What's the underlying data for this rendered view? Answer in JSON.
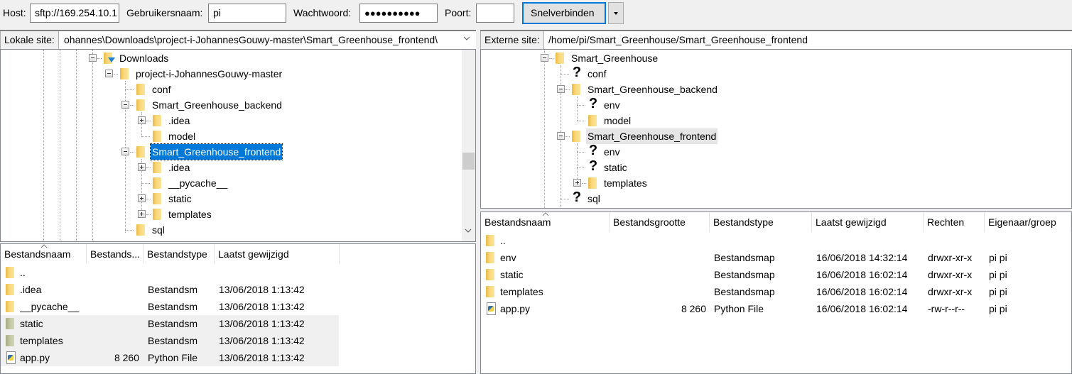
{
  "quickconnect": {
    "host_label": "Host:",
    "host_value": "sftp://169.254.10.1",
    "user_label": "Gebruikersnaam:",
    "user_value": "pi",
    "password_label": "Wachtwoord:",
    "password_value": "●●●●●●●●●●",
    "port_label": "Poort:",
    "port_value": "",
    "connect_label": "Snelverbinden",
    "dropdown_icon": "chevron-down-icon"
  },
  "local": {
    "site_label": "Lokale site:",
    "site_path": "ohannes\\Downloads\\project-i-JohannesGouwy-master\\Smart_Greenhouse_frontend\\",
    "tree": [
      {
        "label": "Downloads",
        "icon": "download-folder-icon",
        "expander": "minus"
      },
      {
        "label": "project-i-JohannesGouwy-master",
        "icon": "folder-icon",
        "expander": "minus"
      },
      {
        "label": "conf",
        "icon": "folder-icon",
        "expander": ""
      },
      {
        "label": "Smart_Greenhouse_backend",
        "icon": "folder-icon",
        "expander": "minus"
      },
      {
        "label": ".idea",
        "icon": "folder-icon",
        "expander": "plus"
      },
      {
        "label": "model",
        "icon": "folder-icon",
        "expander": ""
      },
      {
        "label": "Smart_Greenhouse_frontend",
        "icon": "folder-icon",
        "expander": "minus",
        "selected": true
      },
      {
        "label": ".idea",
        "icon": "folder-icon",
        "expander": "plus"
      },
      {
        "label": "__pycache__",
        "icon": "folder-icon",
        "expander": ""
      },
      {
        "label": "static",
        "icon": "folder-icon",
        "expander": "plus"
      },
      {
        "label": "templates",
        "icon": "folder-icon",
        "expander": "plus"
      },
      {
        "label": "sql",
        "icon": "folder-icon",
        "expander": ""
      }
    ],
    "columns": [
      "Bestandsnaam",
      "Bestands...",
      "Bestandstype",
      "Laatst gewijzigd"
    ],
    "files": [
      {
        "name": "..",
        "size": "",
        "type": "",
        "modified": "",
        "icon": "folder-icon"
      },
      {
        "name": ".idea",
        "size": "",
        "type": "Bestandsm",
        "modified": "13/06/2018 1:13:42",
        "icon": "folder-icon"
      },
      {
        "name": "__pycache__",
        "size": "",
        "type": "Bestandsm",
        "modified": "13/06/2018 1:13:42",
        "icon": "folder-icon"
      },
      {
        "name": "static",
        "size": "",
        "type": "Bestandsm",
        "modified": "13/06/2018 1:13:42",
        "icon": "folder-icon-grey",
        "shaded": true
      },
      {
        "name": "templates",
        "size": "",
        "type": "Bestandsm",
        "modified": "13/06/2018 1:13:42",
        "icon": "folder-icon-grey",
        "shaded": true
      },
      {
        "name": "app.py",
        "size": "8 260",
        "type": "Python File",
        "modified": "13/06/2018 1:13:42",
        "icon": "python-file-icon",
        "shaded": true
      }
    ]
  },
  "remote": {
    "site_label": "Externe site:",
    "site_path": "/home/pi/Smart_Greenhouse/Smart_Greenhouse_frontend",
    "tree": [
      {
        "label": "Smart_Greenhouse",
        "icon": "folder-icon",
        "expander": "minus"
      },
      {
        "label": "conf",
        "icon": "unknown-folder-icon",
        "expander": ""
      },
      {
        "label": "Smart_Greenhouse_backend",
        "icon": "folder-icon",
        "expander": "minus"
      },
      {
        "label": "env",
        "icon": "unknown-folder-icon",
        "expander": ""
      },
      {
        "label": "model",
        "icon": "folder-icon",
        "expander": ""
      },
      {
        "label": "Smart_Greenhouse_frontend",
        "icon": "folder-icon",
        "expander": "minus",
        "highlighted": true
      },
      {
        "label": "env",
        "icon": "unknown-folder-icon",
        "expander": ""
      },
      {
        "label": "static",
        "icon": "unknown-folder-icon",
        "expander": ""
      },
      {
        "label": "templates",
        "icon": "folder-icon",
        "expander": "plus"
      },
      {
        "label": "sql",
        "icon": "unknown-folder-icon",
        "expander": ""
      }
    ],
    "columns": [
      "Bestandsnaam",
      "Bestandsgrootte",
      "Bestandstype",
      "Laatst gewijzigd",
      "Rechten",
      "Eigenaar/groep"
    ],
    "files": [
      {
        "name": "..",
        "size": "",
        "type": "",
        "modified": "",
        "permissions": "",
        "owner": "",
        "icon": "folder-icon"
      },
      {
        "name": "env",
        "size": "",
        "type": "Bestandsmap",
        "modified": "16/06/2018 14:32:14",
        "permissions": "drwxr-xr-x",
        "owner": "pi pi",
        "icon": "folder-icon"
      },
      {
        "name": "static",
        "size": "",
        "type": "Bestandsmap",
        "modified": "16/06/2018 16:02:14",
        "permissions": "drwxr-xr-x",
        "owner": "pi pi",
        "icon": "folder-icon"
      },
      {
        "name": "templates",
        "size": "",
        "type": "Bestandsmap",
        "modified": "16/06/2018 16:02:14",
        "permissions": "drwxr-xr-x",
        "owner": "pi pi",
        "icon": "folder-icon"
      },
      {
        "name": "app.py",
        "size": "8 260",
        "type": "Python File",
        "modified": "16/06/2018 16:02:14",
        "permissions": "-rw-r--r--",
        "owner": "pi pi",
        "icon": "python-file-icon"
      }
    ]
  },
  "colors": {
    "selection": "#0078d7",
    "window_bg": "#f0f0f0",
    "folder": "#f8d775"
  }
}
